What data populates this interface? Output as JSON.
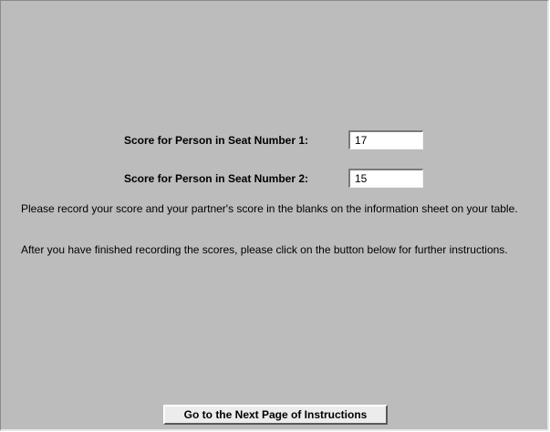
{
  "scores": {
    "seat1": {
      "label": "Score for Person in Seat Number 1:",
      "value": "17"
    },
    "seat2": {
      "label": "Score for Person in Seat Number 2:",
      "value": "15"
    }
  },
  "instructions": {
    "record_text": "Please record your score and your partner's score in the blanks on the information sheet on your table.",
    "next_text": "After you have finished recording the scores, please click on the button below for further instructions."
  },
  "buttons": {
    "next_page_label": "Go to the Next Page of Instructions"
  },
  "colors": {
    "background": "#bcbcbc",
    "button_face": "#ececec",
    "field_background": "#ffffff"
  }
}
